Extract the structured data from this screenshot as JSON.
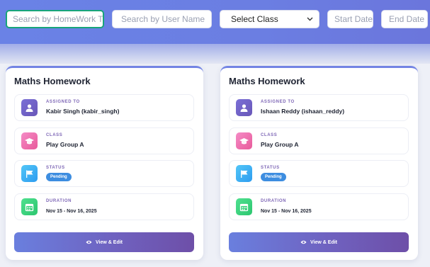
{
  "filters": {
    "homework_title_placeholder": "Search by HomeWork Title",
    "user_name_placeholder": "Search by User Name",
    "class_select_value": "Select Class",
    "start_date_placeholder": "Start Date",
    "end_date_placeholder": "End Date"
  },
  "cards": [
    {
      "title": "Maths Homework",
      "assigned_label": "ASSIGNED TO",
      "assigned_value": "Kabir Singh (kabir_singh)",
      "class_label": "CLASS",
      "class_value": "Play Group A",
      "status_label": "STATUS",
      "status_value": "Pending",
      "duration_label": "DURATION",
      "duration_value": "Nov 15 - Nov 16, 2025",
      "button_label": "View & Edit"
    },
    {
      "title": "Maths Homework",
      "assigned_label": "ASSIGNED TO",
      "assigned_value": "Ishaan Reddy (ishaan_reddy)",
      "class_label": "CLASS",
      "class_value": "Play Group A",
      "status_label": "STATUS",
      "status_value": "Pending",
      "duration_label": "DURATION",
      "duration_value": "Nov 15 - Nov 16, 2025",
      "button_label": "View & Edit"
    }
  ],
  "colors": {
    "accent": "#6b7fe0",
    "focus_border": "#18a57a",
    "status_pending": "#3d8de0"
  },
  "icons": {
    "assigned": "user-icon",
    "class": "graduation-cap-icon",
    "status": "flag-icon",
    "duration": "calendar-icon",
    "view": "eye-icon"
  }
}
